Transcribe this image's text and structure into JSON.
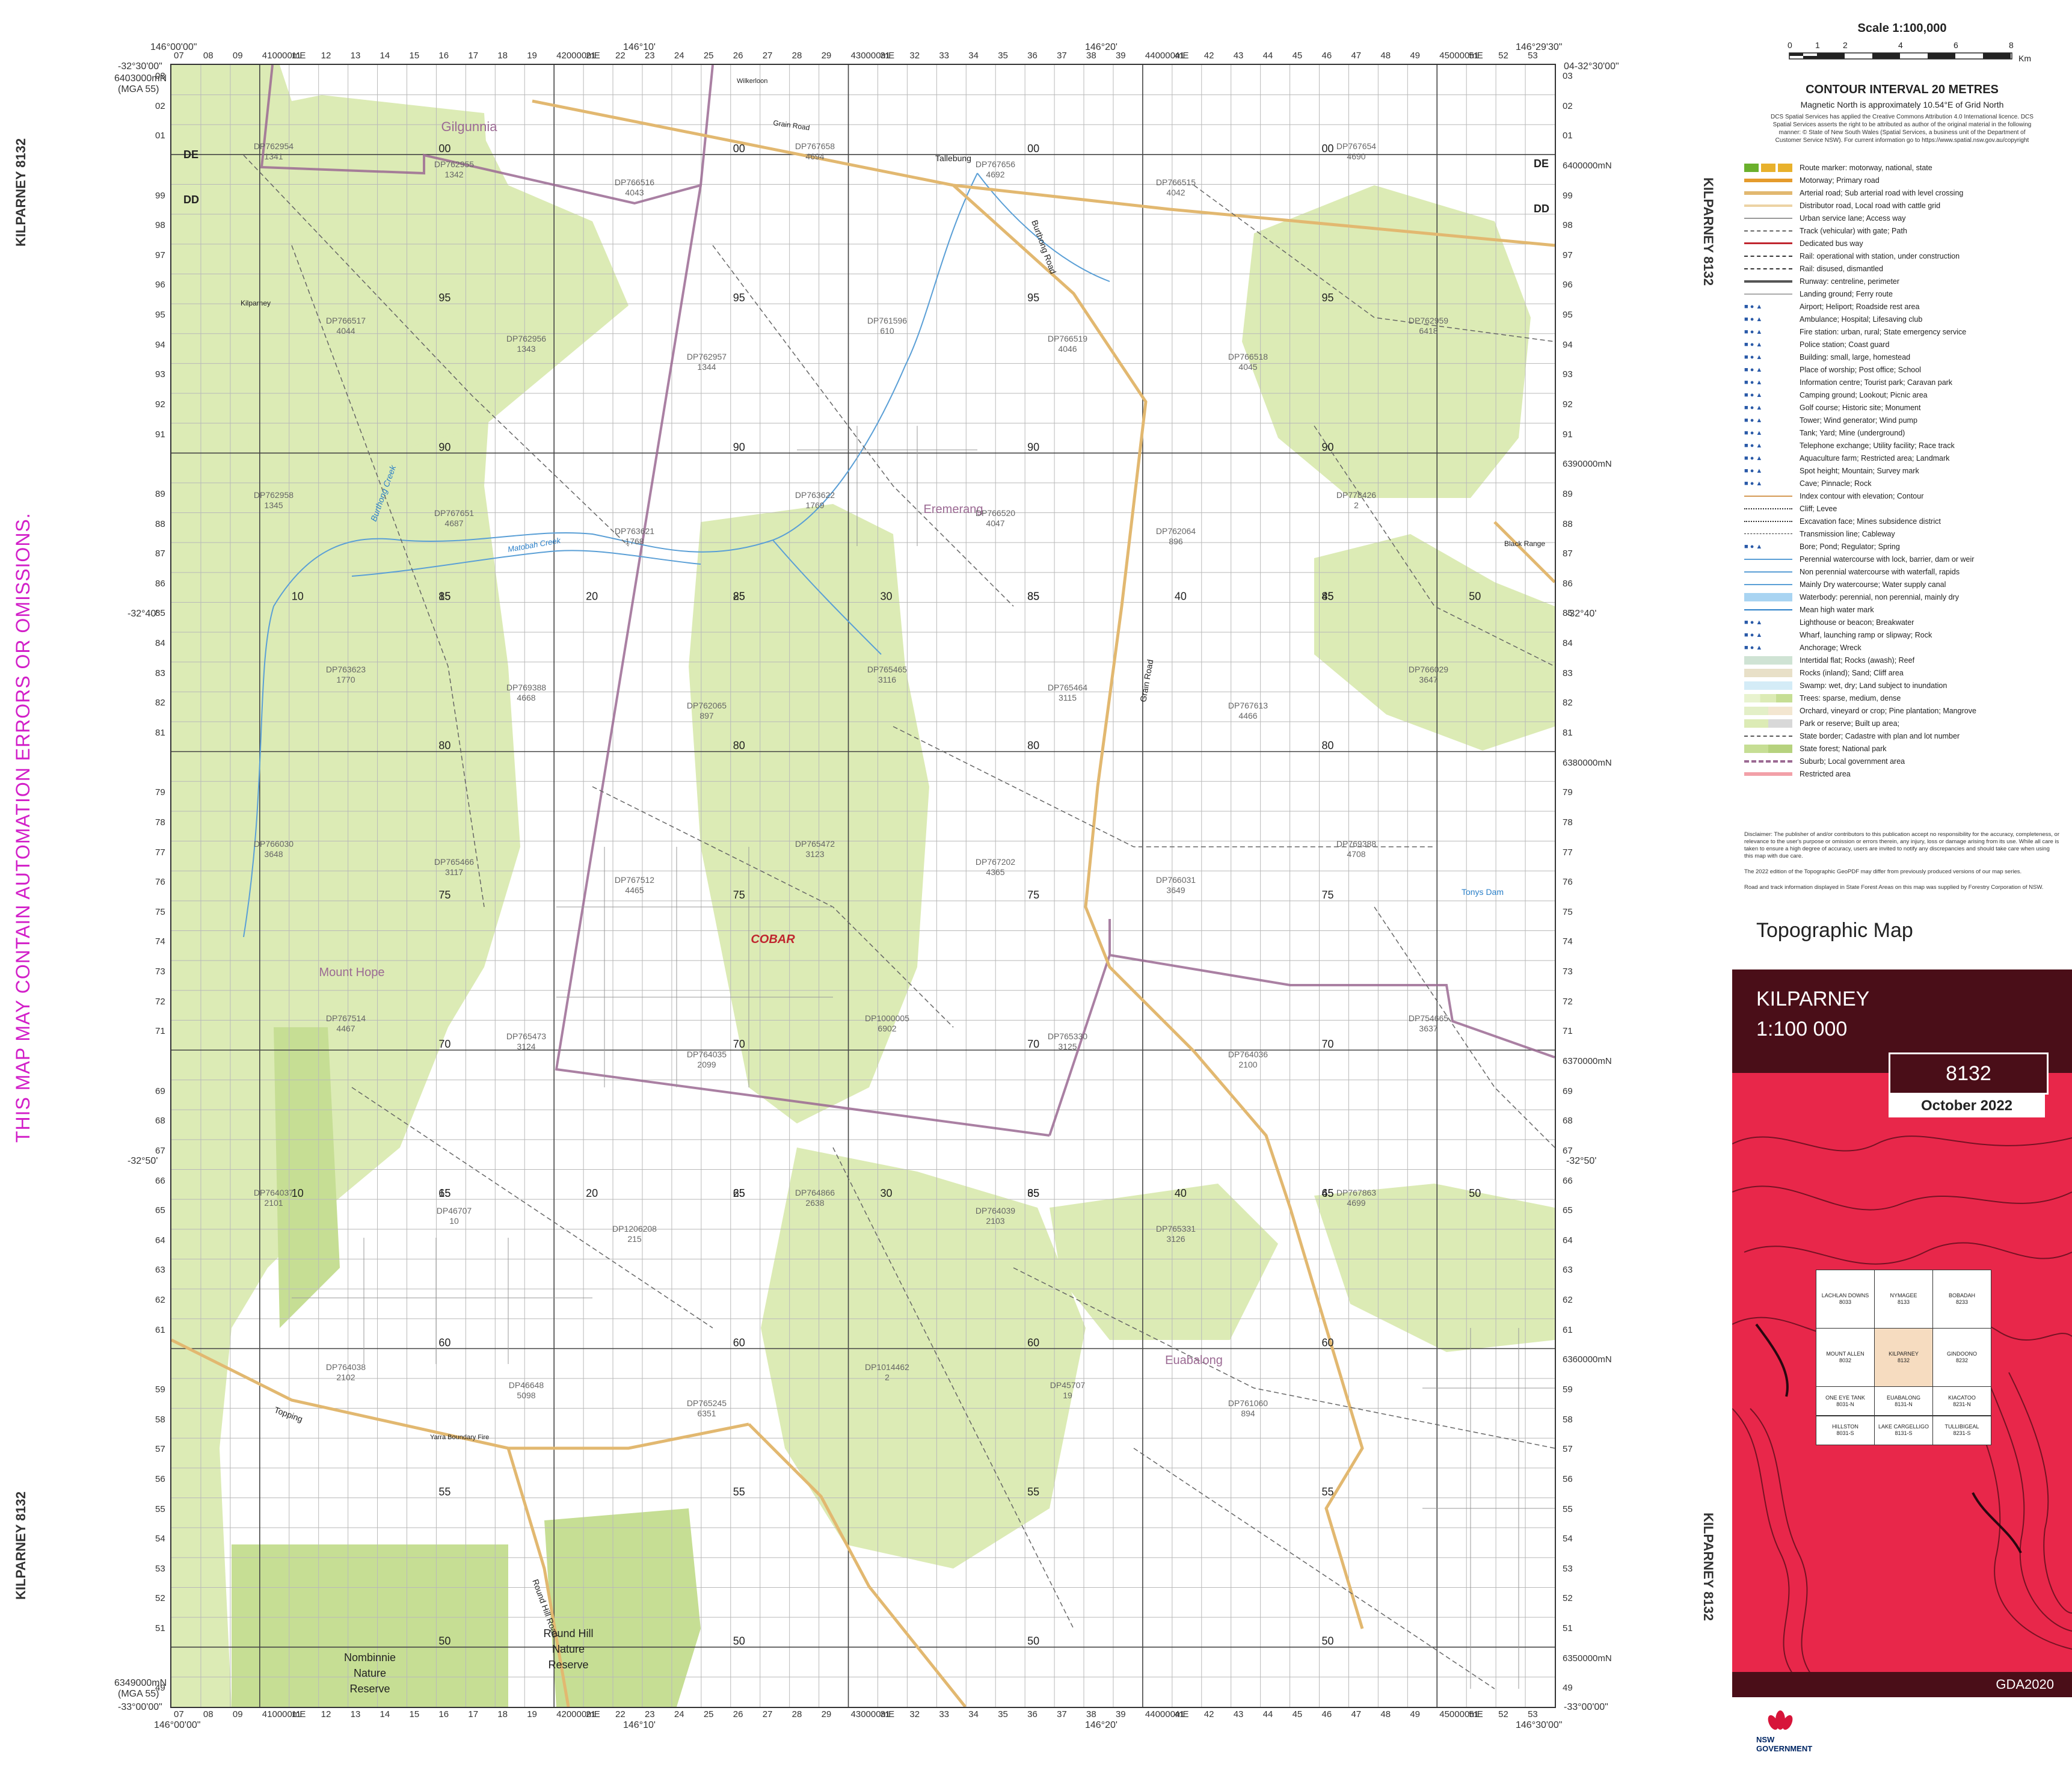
{
  "sheet": {
    "name": "KILPARNEY",
    "number": "8132",
    "side_label": "KILPARNEY 8132",
    "scale_text": "1:100 000",
    "edition_date": "October 2022",
    "datum": "GDA2020",
    "product": "Topographic Map"
  },
  "warning": "THIS MAP MAY CONTAIN AUTOMATION ERRORS OR OMISSIONS.",
  "corners": {
    "top_left_lon": "146°00'00\"",
    "top_left_lat": "-32°30'00\"",
    "top_right_lon": "146°29'30\"",
    "top_right_lat": "04-32°30'00\"",
    "bottom_left_lat": "-33°00'00\"",
    "bottom_left_lon": "146°00'00\"",
    "bottom_right_lat": "-33°00'00\"",
    "bottom_right_lon": "146°30'00\"",
    "top_northing": "6403000mN",
    "top_northing_sub": "(MGA 55)",
    "bottom_northing": "6349000mN",
    "bottom_northing_sub": "(MGA 55)",
    "mid_top_lon_1": "146°10'",
    "mid_top_lon_2": "146°20'",
    "mid_bottom_lon_1": "146°10'",
    "mid_bottom_lon_2": "146°20'",
    "lat_40": "-32°40'",
    "lat_50": "-32°50'"
  },
  "eastings": [
    "07",
    "08",
    "09",
    "410000mE",
    "11",
    "12",
    "13",
    "14",
    "15",
    "16",
    "17",
    "18",
    "19",
    "420000mE",
    "21",
    "22",
    "23",
    "24",
    "25",
    "26",
    "27",
    "28",
    "29",
    "430000mE",
    "31",
    "32",
    "33",
    "34",
    "35",
    "36",
    "37",
    "38",
    "39",
    "440000mE",
    "41",
    "42",
    "43",
    "44",
    "45",
    "46",
    "47",
    "48",
    "49",
    "450000mE",
    "51",
    "52",
    "53"
  ],
  "northings": [
    "03",
    "02",
    "01",
    "6400000mN",
    "99",
    "98",
    "97",
    "96",
    "95",
    "94",
    "93",
    "92",
    "91",
    "6390000mN",
    "89",
    "88",
    "87",
    "86",
    "85",
    "84",
    "83",
    "82",
    "81",
    "6380000mN",
    "79",
    "78",
    "77",
    "76",
    "75",
    "74",
    "73",
    "72",
    "71",
    "6370000mN",
    "69",
    "68",
    "67",
    "66",
    "65",
    "64",
    "63",
    "62",
    "61",
    "6360000mN",
    "59",
    "58",
    "57",
    "56",
    "55",
    "54",
    "53",
    "52",
    "51",
    "6350000mN",
    "49"
  ],
  "zone_codes": [
    "DE",
    "DD",
    "DE",
    "DD"
  ],
  "places": [
    {
      "name": "Gilgunnia",
      "kind": "locality"
    },
    {
      "name": "Eremerang",
      "kind": "locality"
    },
    {
      "name": "Mount Hope",
      "kind": "locality"
    },
    {
      "name": "COBAR",
      "kind": "lga"
    },
    {
      "name": "Euabalong",
      "kind": "locality"
    },
    {
      "name": "Nombinnie Nature Reserve",
      "kind": "reserve"
    },
    {
      "name": "Round Hill Nature Reserve",
      "kind": "reserve"
    },
    {
      "name": "Kilparney",
      "kind": "homestead"
    },
    {
      "name": "Tallebung",
      "kind": "locality"
    },
    {
      "name": "Black Range",
      "kind": "feature"
    },
    {
      "name": "Tonys Dam",
      "kind": "water"
    }
  ],
  "roads": [
    "Grain Road",
    "Burthong Road",
    "Topping",
    "Yarra Boundary Fire",
    "Round Hill Road",
    "Wilkerloon",
    "Grain Road"
  ],
  "creeks": [
    "Burthong Creek",
    "Matobah Creek"
  ],
  "lots": [
    {
      "dp": "DP762954",
      "lot": "1341"
    },
    {
      "dp": "DP762955",
      "lot": "1342"
    },
    {
      "dp": "DP766516",
      "lot": "4043"
    },
    {
      "dp": "DP767658",
      "lot": "4694"
    },
    {
      "dp": "DP767656",
      "lot": "4692"
    },
    {
      "dp": "DP766515",
      "lot": "4042"
    },
    {
      "dp": "DP767654",
      "lot": "4690"
    },
    {
      "dp": "DP766517",
      "lot": "4044"
    },
    {
      "dp": "DP762956",
      "lot": "1343"
    },
    {
      "dp": "DP762957",
      "lot": "1344"
    },
    {
      "dp": "DP761596",
      "lot": "610"
    },
    {
      "dp": "DP766519",
      "lot": "4046"
    },
    {
      "dp": "DP766518",
      "lot": "4045"
    },
    {
      "dp": "DP762959",
      "lot": "6418"
    },
    {
      "dp": "DP762958",
      "lot": "1345"
    },
    {
      "dp": "DP767651",
      "lot": "4687"
    },
    {
      "dp": "DP763621",
      "lot": "1768"
    },
    {
      "dp": "DP763622",
      "lot": "1769"
    },
    {
      "dp": "DP766520",
      "lot": "4047"
    },
    {
      "dp": "DP762064",
      "lot": "896"
    },
    {
      "dp": "DP778426",
      "lot": "2"
    },
    {
      "dp": "DP763623",
      "lot": "1770"
    },
    {
      "dp": "DP769388",
      "lot": "4668"
    },
    {
      "dp": "DP762065",
      "lot": "897"
    },
    {
      "dp": "DP765465",
      "lot": "3116"
    },
    {
      "dp": "DP765464",
      "lot": "3115"
    },
    {
      "dp": "DP767613",
      "lot": "4466"
    },
    {
      "dp": "DP766029",
      "lot": "3647"
    },
    {
      "dp": "DP766030",
      "lot": "3648"
    },
    {
      "dp": "DP765466",
      "lot": "3117"
    },
    {
      "dp": "DP767512",
      "lot": "4465"
    },
    {
      "dp": "DP765472",
      "lot": "3123"
    },
    {
      "dp": "DP767202",
      "lot": "4365"
    },
    {
      "dp": "DP766031",
      "lot": "3649"
    },
    {
      "dp": "DP769388",
      "lot": "4708"
    },
    {
      "dp": "DP767514",
      "lot": "4467"
    },
    {
      "dp": "DP765473",
      "lot": "3124"
    },
    {
      "dp": "DP764035",
      "lot": "2099"
    },
    {
      "dp": "DP1000005",
      "lot": "6902"
    },
    {
      "dp": "DP765330",
      "lot": "3125"
    },
    {
      "dp": "DP764036",
      "lot": "2100"
    },
    {
      "dp": "DP754665",
      "lot": "3637"
    },
    {
      "dp": "DP764037",
      "lot": "2101"
    },
    {
      "dp": "DP46707",
      "lot": "10"
    },
    {
      "dp": "DP1206208",
      "lot": "215"
    },
    {
      "dp": "DP764866",
      "lot": "2638"
    },
    {
      "dp": "DP764039",
      "lot": "2103"
    },
    {
      "dp": "DP765331",
      "lot": "3126"
    },
    {
      "dp": "DP767863",
      "lot": "4699"
    },
    {
      "dp": "DP764038",
      "lot": "2102"
    },
    {
      "dp": "DP46648",
      "lot": "5098"
    },
    {
      "dp": "DP765245",
      "lot": "6351"
    },
    {
      "dp": "DP1014462",
      "lot": "2"
    },
    {
      "dp": "DP45707",
      "lot": "19"
    },
    {
      "dp": "DP761060",
      "lot": "894"
    }
  ],
  "grid_labels": {
    "eastings_major": [
      "10",
      "15",
      "20",
      "25",
      "30",
      "35",
      "40",
      "45",
      "50"
    ],
    "northings_major": [
      "00",
      "95",
      "90",
      "85",
      "80",
      "75",
      "70",
      "65",
      "60",
      "55",
      "50"
    ]
  },
  "panel": {
    "scale_title": "Scale 1:100,000",
    "scale_ticks": [
      "0",
      "1",
      "2",
      "4",
      "6",
      "8"
    ],
    "scale_unit": "Km",
    "contour_title": "CONTOUR INTERVAL 20 METRES",
    "magnetic": "Magnetic North is approximately 10.54°E of Grid North",
    "copyright": "DCS Spatial Services has applied the Creative Commons Attribution 4.0 International licence. DCS Spatial Services asserts the right to be attributed as author of the original material in the following manner: © State of New South Wales (Spatial Services, a business unit of the Department of Customer Service NSW). For current information go to https://www.spatial.nsw.gov.au/copyright",
    "legend": [
      "Route marker: motorway, national, state",
      "Motorway; Primary road",
      "Arterial road; Sub arterial road with level crossing",
      "Distributor road, Local road with cattle grid",
      "Urban service lane; Access way",
      "Track (vehicular) with gate; Path",
      "Dedicated bus way",
      "Rail: operational with station, under construction",
      "Rail: disused, dismantled",
      "Runway: centreline, perimeter",
      "Landing ground; Ferry route",
      "Airport; Heliport; Roadside rest area",
      "Ambulance; Hospital; Lifesaving club",
      "Fire station: urban, rural; State emergency service",
      "Police station; Coast guard",
      "Building: small, large, homestead",
      "Place of worship; Post office; School",
      "Information centre; Tourist park; Caravan park",
      "Camping ground; Lookout; Picnic area",
      "Golf course; Historic site; Monument",
      "Tower; Wind generator; Wind pump",
      "Tank; Yard; Mine (underground)",
      "Telephone exchange; Utility facility; Race track",
      "Aquaculture farm; Restricted area; Landmark",
      "Spot height; Mountain; Survey mark",
      "Cave; Pinnacle; Rock",
      "Index contour with elevation; Contour",
      "Cliff; Levee",
      "Excavation face; Mines subsidence district",
      "Transmission line; Cableway",
      "Bore; Pond; Regulator; Spring",
      "Perennial watercourse with lock, barrier, dam or weir",
      "Non perennial watercourse with waterfall, rapids",
      "Mainly Dry watercourse; Water supply canal",
      "Waterbody: perennial, non perennial, mainly dry",
      "Mean high water mark",
      "Lighthouse or beacon; Breakwater",
      "Wharf, launching ramp or slipway; Rock",
      "Anchorage; Wreck",
      "Intertidal flat; Rocks (awash); Reef",
      "Rocks (inland); Sand; Cliff area",
      "Swamp: wet, dry; Land subject to inundation",
      "Trees: sparse, medium, dense",
      "Orchard, vineyard or crop; Pine plantation; Mangrove",
      "Park or reserve; Built up area;",
      "State border; Cadastre with plan and lot number",
      "State forest; National park",
      "Suburb; Local government area",
      "Restricted area"
    ],
    "disclaimer": "Disclaimer: The publisher of and/or contributors to this publication accept no responsibility for the accuracy, completeness, or relevance to the user's purpose or omission or errors therein, any injury, loss or damage arising from its use. While all care is taken to ensure a high degree of accuracy, users are invited to notify any discrepancies and should take care when using this map with due care.",
    "disclaimer2": "The 2022 edition of the Topographic GeoPDF may differ from previously produced versions of our map series.",
    "disclaimer3": "Road and track information displayed in State Forest Areas on this map was supplied by Forestry Corporation of NSW.",
    "index": [
      {
        "name": "LACHLAN DOWNS",
        "num": "8033"
      },
      {
        "name": "NYMAGEE",
        "num": "8133"
      },
      {
        "name": "BOBADAH",
        "num": "8233"
      },
      {
        "name": "MOUNT ALLEN",
        "num": "8032"
      },
      {
        "name": "KILPARNEY",
        "num": "8132"
      },
      {
        "name": "GINDOONO",
        "num": "8232"
      },
      {
        "name": "ONE EYE TANK",
        "num": "8031-N"
      },
      {
        "name": "EUABALONG",
        "num": "8131-N"
      },
      {
        "name": "KIACATOO",
        "num": "8231-N"
      },
      {
        "name": "HILLSTON",
        "num": "8031-S"
      },
      {
        "name": "LAKE CARGELLIGO",
        "num": "8131-S"
      },
      {
        "name": "TULLIBIGEAL",
        "num": "8231-S"
      }
    ],
    "agency": "NSW GOVERNMENT"
  },
  "colors": {
    "vegetation": "#dcebb5",
    "vegetation_dark": "#c6de94",
    "road_major": "#e2b870",
    "lga_boundary": "#9b6a93",
    "cover_red": "#e8274a",
    "cover_dark": "#4a0e18",
    "warning": "#d21ec8",
    "water": "#5a9fd6"
  }
}
